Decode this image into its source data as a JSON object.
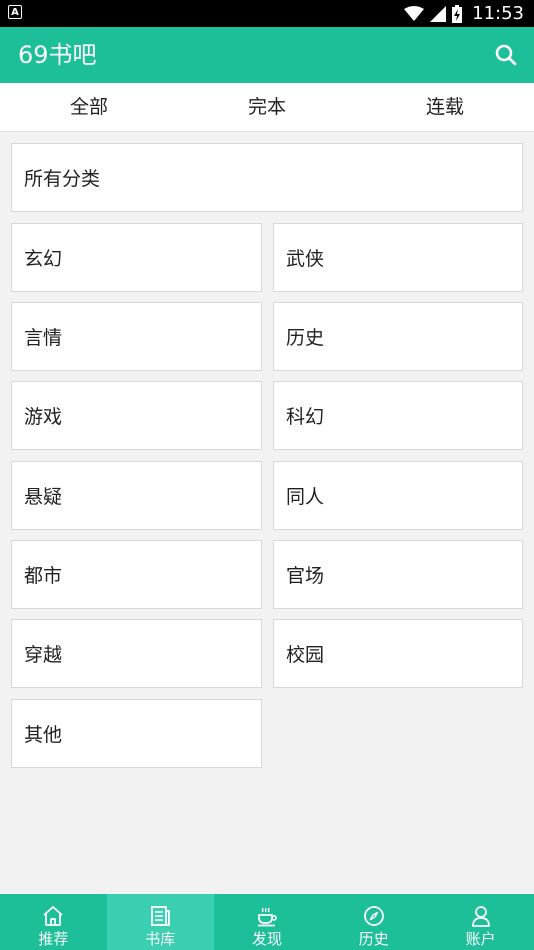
{
  "status": {
    "time": "11:53"
  },
  "appbar": {
    "title": "69书吧"
  },
  "tabs": [
    {
      "label": "全部"
    },
    {
      "label": "完本"
    },
    {
      "label": "连载"
    }
  ],
  "categories": {
    "all_label": "所有分类",
    "items": [
      {
        "label": "玄幻"
      },
      {
        "label": "武侠"
      },
      {
        "label": "言情"
      },
      {
        "label": "历史"
      },
      {
        "label": "游戏"
      },
      {
        "label": "科幻"
      },
      {
        "label": "悬疑"
      },
      {
        "label": "同人"
      },
      {
        "label": "都市"
      },
      {
        "label": "官场"
      },
      {
        "label": "穿越"
      },
      {
        "label": "校园"
      },
      {
        "label": "其他"
      }
    ]
  },
  "bottom_nav": [
    {
      "label": "推荐",
      "icon": "home-icon"
    },
    {
      "label": "书库",
      "icon": "book-icon",
      "active": true
    },
    {
      "label": "发现",
      "icon": "coffee-icon"
    },
    {
      "label": "历史",
      "icon": "compass-icon"
    },
    {
      "label": "账户",
      "icon": "user-icon"
    }
  ],
  "colors": {
    "accent": "#1dbf98",
    "accent_active": "#39cfb0"
  }
}
